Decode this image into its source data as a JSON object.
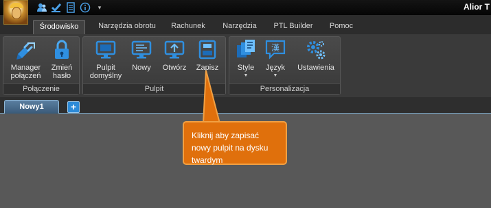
{
  "window": {
    "title": "Alior T"
  },
  "quick_access": [
    {
      "icon": "users-icon"
    },
    {
      "icon": "checkmark-icon"
    },
    {
      "icon": "document-icon"
    },
    {
      "icon": "info-icon"
    },
    {
      "icon": "customize-dropdown-icon",
      "glyph": "▾"
    }
  ],
  "tabs": [
    {
      "label": "Środowisko",
      "active": true
    },
    {
      "label": "Narzędzia obrotu"
    },
    {
      "label": "Rachunek"
    },
    {
      "label": "Narzędzia"
    },
    {
      "label": "PTL Builder"
    },
    {
      "label": "Pomoc"
    }
  ],
  "ribbon": {
    "groups": [
      {
        "label": "Połączenie",
        "buttons": [
          {
            "label": "Manager\npołączeń",
            "icon": "plug-icon"
          },
          {
            "label": "Zmień\nhasło",
            "icon": "lock-icon"
          }
        ]
      },
      {
        "label": "Pulpit",
        "buttons": [
          {
            "label": "Pulpit\ndomyślny",
            "icon": "default-desktop-icon"
          },
          {
            "label": "Nowy",
            "icon": "new-desktop-icon"
          },
          {
            "label": "Otwórz",
            "icon": "open-desktop-icon"
          },
          {
            "label": "Zapisz",
            "icon": "save-desktop-icon"
          }
        ]
      },
      {
        "label": "Personalizacja",
        "buttons": [
          {
            "label": "Style",
            "icon": "styles-icon",
            "dropdown": true
          },
          {
            "label": "Język",
            "icon": "language-icon",
            "dropdown": true
          },
          {
            "label": "Ustawienia",
            "icon": "settings-icon"
          }
        ]
      }
    ]
  },
  "document_tabs": [
    {
      "label": "Nowy1",
      "active": true
    }
  ],
  "add_tab": {
    "glyph": "+"
  },
  "tooltip": {
    "text": "Kliknij aby zapisać nowy pulpit na dysku twardym"
  },
  "colors": {
    "accent": "#2d8bd8",
    "tooltip": "#e0700c"
  }
}
